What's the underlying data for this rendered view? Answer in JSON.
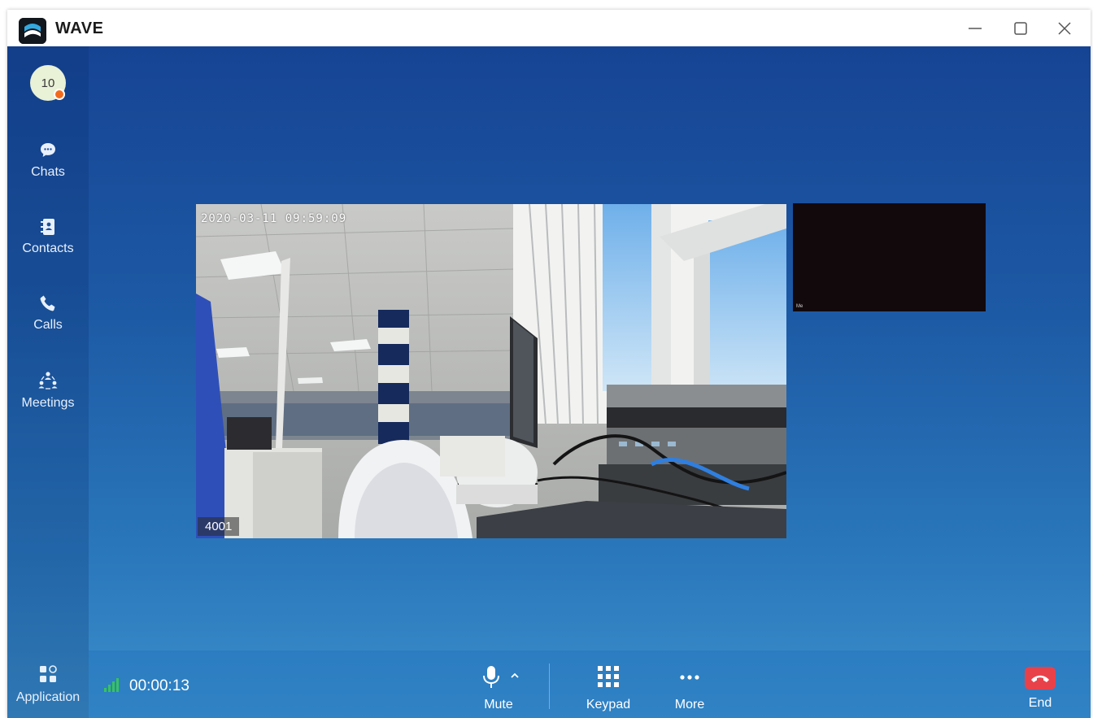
{
  "app": {
    "title": "WAVE"
  },
  "user": {
    "avatar_text": "10",
    "presence_color": "#f26b1d"
  },
  "sidebar": {
    "items": [
      {
        "label": "Chats",
        "icon": "chat-icon"
      },
      {
        "label": "Contacts",
        "icon": "contacts-icon"
      },
      {
        "label": "Calls",
        "icon": "phone-icon"
      },
      {
        "label": "Meetings",
        "icon": "meetings-icon"
      }
    ],
    "bottom_item": {
      "label": "Application",
      "icon": "apps-icon"
    }
  },
  "video": {
    "main": {
      "timestamp": "2020-03-11 09:59:09",
      "caller_id": "4001"
    },
    "self": {
      "label": "Me"
    }
  },
  "call_bar": {
    "duration": "00:00:13",
    "controls": [
      {
        "label": "Mute",
        "icon": "microphone-icon"
      },
      {
        "label": "Keypad",
        "icon": "keypad-icon"
      },
      {
        "label": "More",
        "icon": "more-icon"
      },
      {
        "label": "End",
        "icon": "end-call-icon"
      }
    ]
  },
  "colors": {
    "end_button": "#e9414a",
    "signal": "#37c45a",
    "background_top": "#164494",
    "background_bottom": "#3b8fcb"
  }
}
